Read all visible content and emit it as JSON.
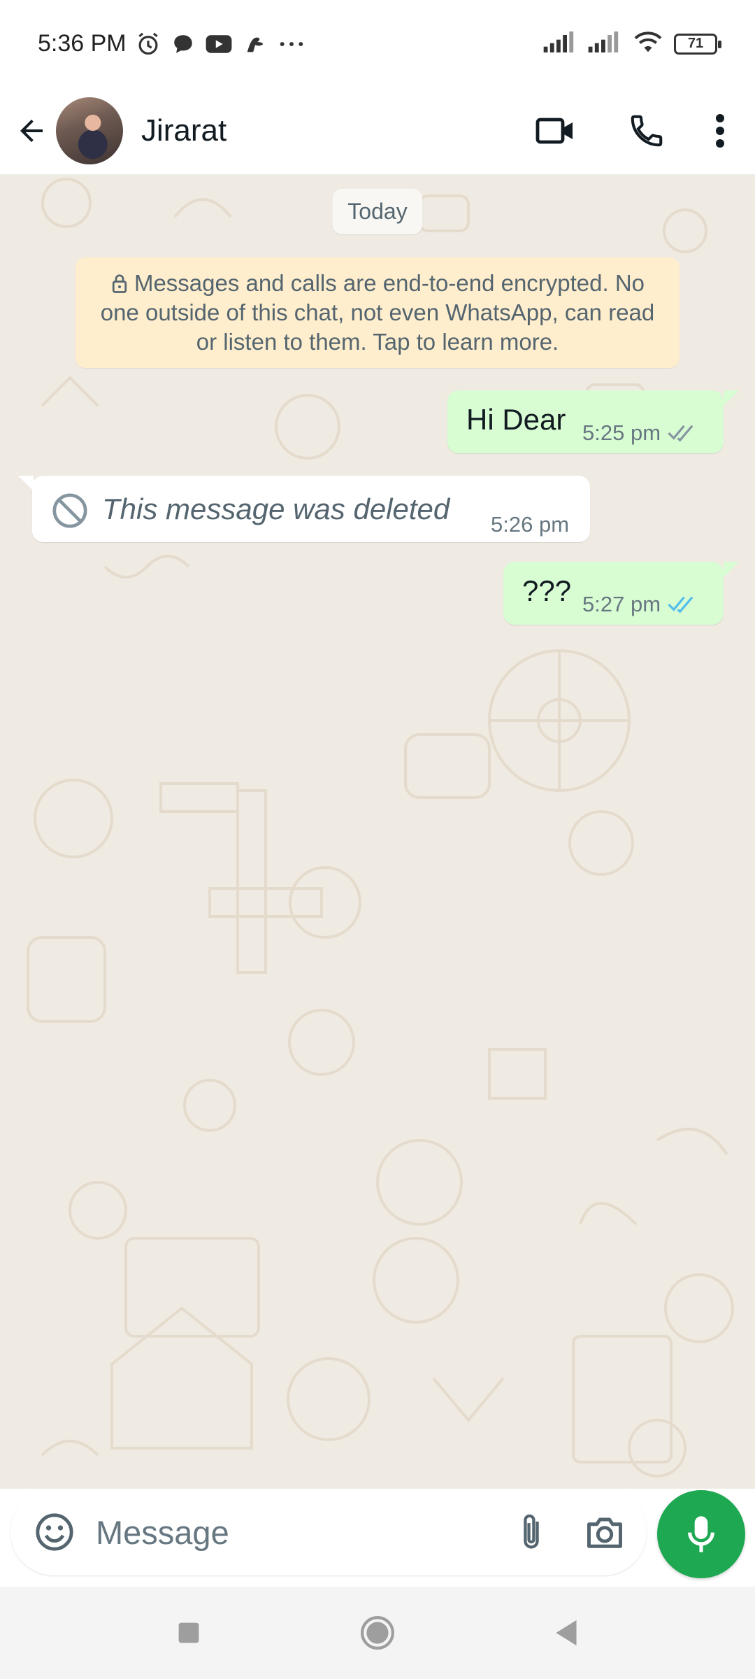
{
  "status_bar": {
    "time": "5:36 PM",
    "battery": "71",
    "icons": [
      "alarm-icon",
      "chat-icon",
      "youtube-icon",
      "app-icon",
      "more-dots-icon",
      "signal-icon",
      "signal-icon",
      "wifi-icon",
      "battery-icon"
    ]
  },
  "header": {
    "contact_name": "Jirarat",
    "icons": [
      "back-arrow-icon",
      "video-call-icon",
      "voice-call-icon",
      "more-vert-icon"
    ]
  },
  "chat": {
    "date_chip": "Today",
    "encryption_notice": "Messages and calls are end-to-end encrypted. No one outside of this chat, not even WhatsApp, can read or listen to them. Tap to learn more.",
    "messages": [
      {
        "direction": "outgoing",
        "text": "Hi Dear",
        "time": "5:25 pm",
        "status": "delivered"
      },
      {
        "direction": "incoming",
        "text": "This message was deleted",
        "time": "5:26 pm",
        "deleted": true
      },
      {
        "direction": "outgoing",
        "text": "???",
        "time": "5:27 pm",
        "status": "read"
      }
    ]
  },
  "composer": {
    "placeholder": "Message",
    "value": ""
  },
  "colors": {
    "outgoing_bubble": "#d9fdd3",
    "incoming_bubble": "#ffffff",
    "notice_bg": "#ffeecd",
    "mic_green": "#1da851",
    "read_tick_blue": "#53bdeb",
    "chat_bg": "#efeae2"
  }
}
